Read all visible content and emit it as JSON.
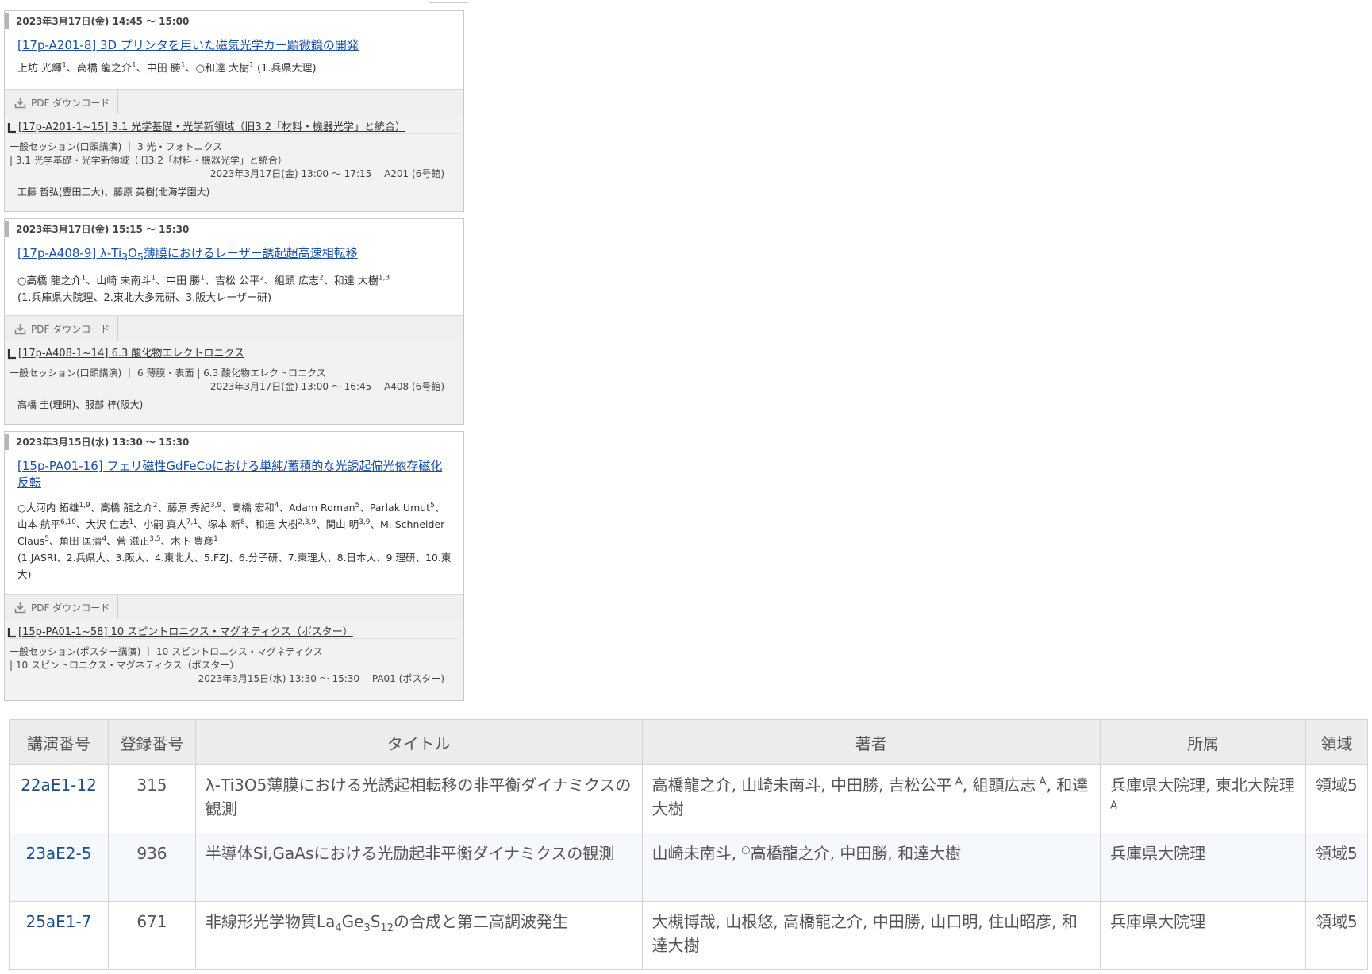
{
  "cards": [
    {
      "datetime": "2023年3月17日(金) 14:45 〜 15:00",
      "title": "[17p-A201-8] 3D プリンタを用いた磁気光学カー顕微鏡の開発",
      "authors_html": "上坊 光輝<sup>1</sup>、高橋 龍之介<sup>1</sup>、中田 勝<sup>1</sup>、○和達 大樹<sup>1</sup> (1.兵県大理)",
      "pdf_label": "PDF ダウンロード",
      "session_link": "[17p-A201-1~15] 3.1 光学基礎・光学新領域（旧3.2「材料・機器光学」と統合）",
      "session_meta_1": "一般セッション(口頭講演) ｜ 3 光・フォトニクス",
      "session_meta_2": "| 3.1 光学基礎・光学新領域（旧3.2「材料・機器光学」と統合）",
      "session_time": "2023年3月17日(金) 13:00 〜 17:15　 A201 (6号館)",
      "chairs": "工藤 哲弘(豊田工大)、藤原 英樹(北海学園大)"
    },
    {
      "datetime": "2023年3月17日(金) 15:15 〜 15:30",
      "title_html": "[17p-A408-9] λ-Ti<sub>3</sub>O<sub>5</sub>薄膜におけるレーザー誘起超高速相転移",
      "authors_html": "○高橋 龍之介<sup>1</sup>、山崎 未南斗<sup>1</sup>、中田 勝<sup>1</sup>、吉松 公平<sup>2</sup>、組頭 広志<sup>2</sup>、和達 大樹<sup>1,3</sup>",
      "affil": "(1.兵庫県大院理、2.東北大多元研、3.阪大レーザー研)",
      "pdf_label": "PDF ダウンロード",
      "session_link": "[17p-A408-1~14] 6.3 酸化物エレクトロニクス",
      "session_meta_1": "一般セッション(口頭講演) ｜ 6 薄膜・表面 | 6.3 酸化物エレクトロニクス",
      "session_time": "2023年3月17日(金) 13:00 〜 16:45　 A408 (6号館)",
      "chairs": "高橋 圭(理研)、服部 梓(阪大)"
    },
    {
      "datetime": "2023年3月15日(水) 13:30 〜 15:30",
      "title": "[15p-PA01-16] フェリ磁性GdFeCoにおける単純/蓄積的な光誘起偏光依存磁化反転",
      "authors_html": "○大河内 拓雄<sup>1,9</sup>、高橋 龍之介<sup>2</sup>、藤原 秀紀<sup>3,9</sup>、高橋 宏和<sup>4</sup>、Adam Roman<sup>5</sup>、Parlak Umut<sup>5</sup>、山本 航平<sup>6,10</sup>、大沢 仁志<sup>1</sup>、小嗣 真人<sup>7,1</sup>、塚本 新<sup>8</sup>、和達 大樹<sup>2,3,9</sup>、関山 明<sup>3,9</sup>、M. Schneider Claus<sup>5</sup>、角田 匡清<sup>4</sup>、菅 滋正<sup>3,5</sup>、木下 豊彦<sup>1</sup>",
      "affil": "(1.JASRI、2.兵県大、3.阪大、4.東北大、5.FZJ、6.分子研、7.東理大、8.日本大、9.理研、10.東大)",
      "pdf_label": "PDF ダウンロード",
      "session_link": "[15p-PA01-1~58] 10 スピントロニクス・マグネティクス（ポスター）",
      "session_meta_1": "一般セッション(ポスター講演) ｜ 10 スピントロニクス・マグネティクス",
      "session_meta_2": "| 10 スピントロニクス・マグネティクス（ポスター）",
      "session_time": "2023年3月15日(水) 13:30 〜 15:30　 PA01 (ポスター)"
    }
  ],
  "table": {
    "headers": [
      "講演番号",
      "登録番号",
      "タイトル",
      "著者",
      "所属",
      "領域"
    ],
    "rows": [
      {
        "num": "22aE1-12",
        "reg": "315",
        "title_html": "λ-Ti3O5薄膜における光誘起相転移の非平衡ダイナミクスの観測",
        "authors_html": "高橋龍之介, 山崎未南斗, 中田勝, 吉松公平<sup> A</sup>, 組頭広志<sup> A</sup>, 和達大樹",
        "affil_html": "兵庫県大院理, 東北大院理<sup> A</sup>",
        "area": "領域5"
      },
      {
        "num": "23aE2-5",
        "reg": "936",
        "title_html": "半導体Si,GaAsにおける光励起非平衡ダイナミクスの観測",
        "authors_html": "山崎未南斗, <sup>○</sup>高橋龍之介, 中田勝, 和達大樹",
        "affil_html": "兵庫県大院理",
        "area": "領域5"
      },
      {
        "num": "25aE1-7",
        "reg": "671",
        "title_html": "非線形光学物質La<sub>4</sub>Ge<sub>3</sub>S<sub>12</sub>の合成と第二高調波発生",
        "authors_html": "大槻博哉, 山根悠, 高橋龍之介, 中田勝, 山口明, 住山昭彦, 和達大樹",
        "affil_html": "兵庫県大院理",
        "area": "領域5"
      }
    ]
  }
}
